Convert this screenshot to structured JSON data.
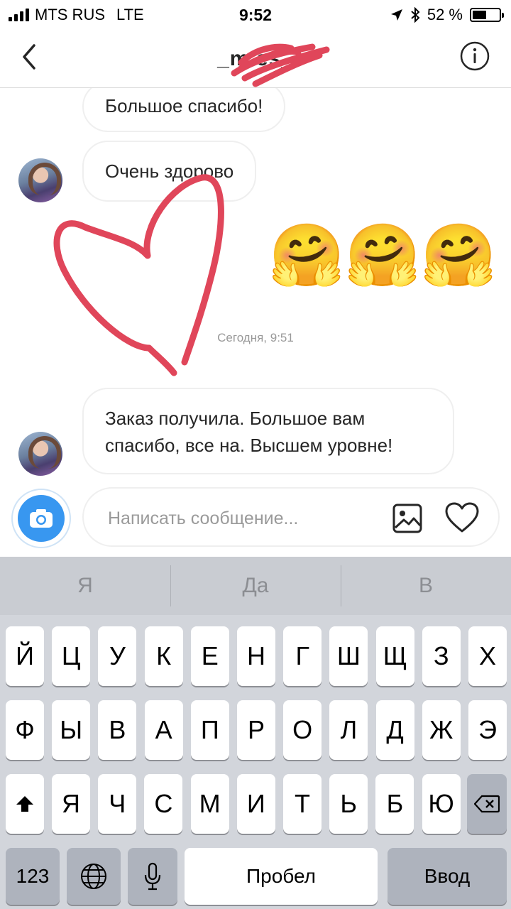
{
  "status_bar": {
    "carrier": "MTS RUS",
    "network": "LTE",
    "time": "9:52",
    "battery_percent_label": "52 %",
    "battery_level": 0.52,
    "icons": [
      "signal-bars",
      "location-arrow",
      "bluetooth",
      "battery"
    ]
  },
  "header": {
    "title": "_m       es_",
    "back_icon": "chevron-left",
    "info_icon": "info-circle"
  },
  "messages": [
    {
      "sender": "other",
      "text": "Большое спасибо!"
    },
    {
      "sender": "other",
      "text": "Очень здорово"
    },
    {
      "sender": "me",
      "text": "🤗🤗🤗"
    },
    {
      "sender": "system",
      "text": "Сегодня, 9:51"
    },
    {
      "sender": "other",
      "text_line1": "Заказ получила. Большое вам",
      "text_line2": "спасибо, все на. Высшем уровне!"
    }
  ],
  "composer": {
    "placeholder": "Написать сообщение...",
    "camera_icon": "camera",
    "gallery_icon": "image",
    "like_icon": "heart"
  },
  "keyboard": {
    "suggestions": [
      "Я",
      "Да",
      "В"
    ],
    "row1": [
      "Й",
      "Ц",
      "У",
      "К",
      "Е",
      "Н",
      "Г",
      "Ш",
      "Щ",
      "З",
      "Х"
    ],
    "row2": [
      "Ф",
      "Ы",
      "В",
      "А",
      "П",
      "Р",
      "О",
      "Л",
      "Д",
      "Ж",
      "Э"
    ],
    "row3": [
      "Я",
      "Ч",
      "С",
      "М",
      "И",
      "Т",
      "Ь",
      "Б",
      "Ю"
    ],
    "numbers_label": "123",
    "space_label": "Пробел",
    "return_label": "Ввод"
  },
  "colors": {
    "accent_blue": "#3897f0",
    "heart_red": "#e0465a",
    "keyboard_bg": "#d2d5db"
  }
}
